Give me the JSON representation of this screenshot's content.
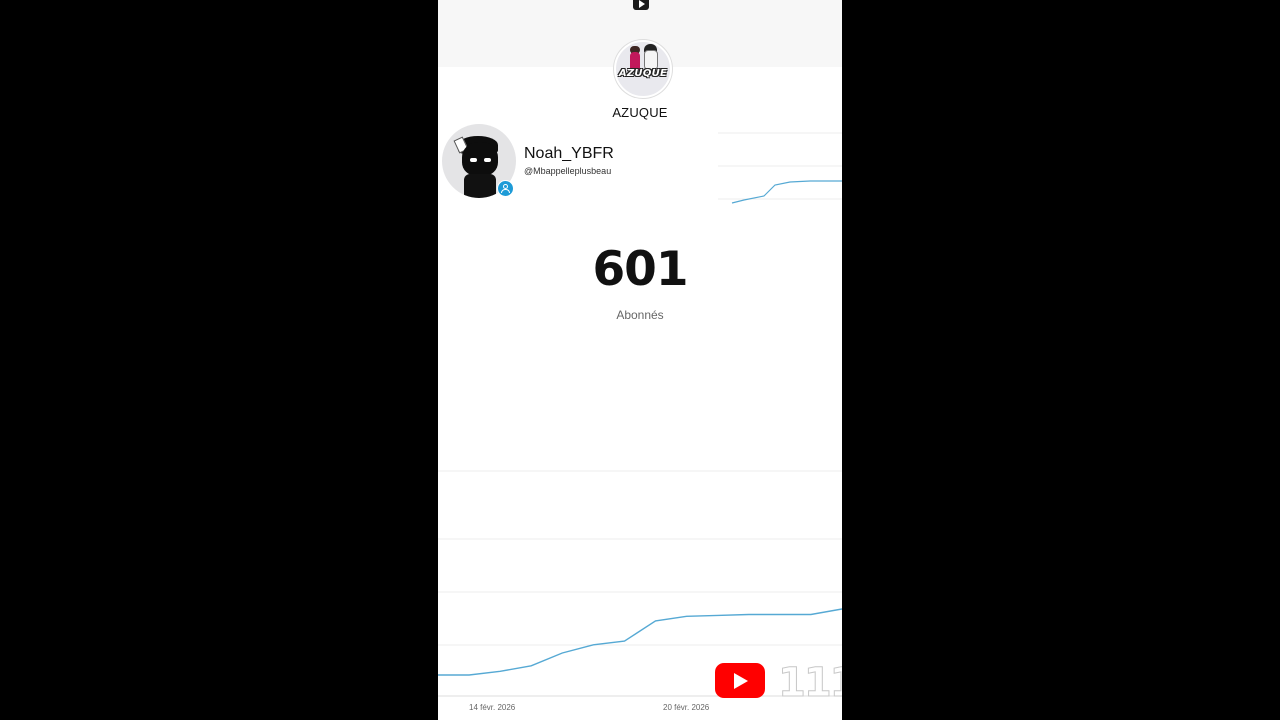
{
  "channel": {
    "name": "AZUQUE",
    "logo_text": "AZUQUE"
  },
  "user": {
    "name": "Noah_YBFR",
    "handle": "@Mbappelleplusbeau"
  },
  "stats": {
    "subscribers": "601",
    "subscribers_label": "Abonnés"
  },
  "chart": {
    "x_labels": [
      "14 févr. 2026",
      "20 févr. 2026"
    ],
    "line_color": "#56a9d4"
  },
  "chart_data": {
    "type": "line",
    "title": "",
    "xlabel": "",
    "ylabel": "",
    "x": [
      1,
      2,
      3,
      4,
      5,
      6,
      7,
      8,
      9,
      10,
      11,
      12,
      13,
      14
    ],
    "series": [
      {
        "values": [
          0,
          0,
          4,
          10,
          24,
          33,
          37,
          59,
          64,
          65,
          66,
          66,
          66,
          72
        ]
      }
    ],
    "x_tick_labels": [
      "14 févr. 2026",
      "20 févr. 2026"
    ],
    "grid": true,
    "legend": "none"
  },
  "watermark": "111",
  "icons": {
    "top": "youtube-mini-icon",
    "badge": "verified-person-icon",
    "brand": "youtube-logo-icon"
  }
}
